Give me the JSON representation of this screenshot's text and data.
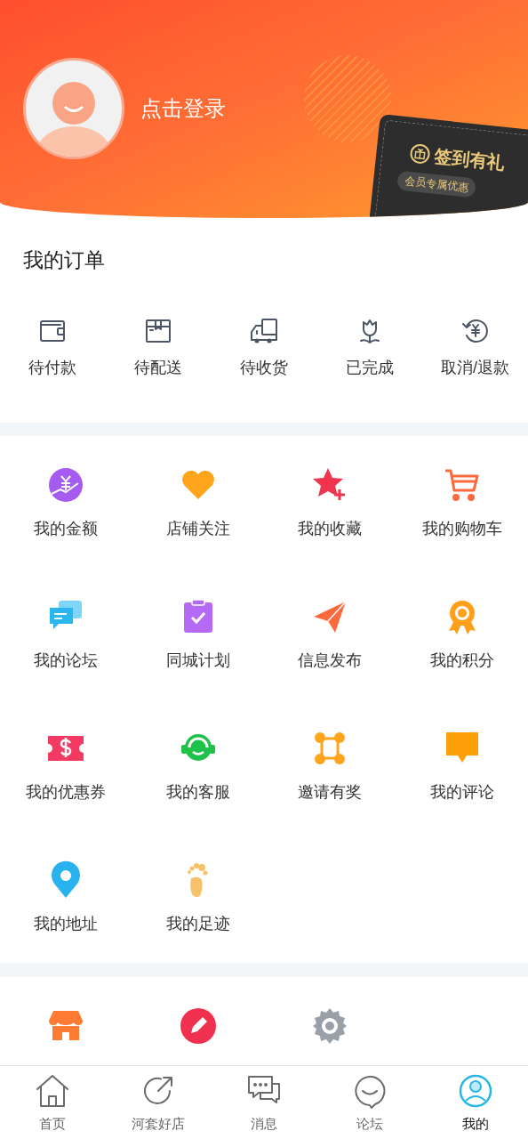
{
  "header": {
    "login_text": "点击登录",
    "sign_in": {
      "title": "签到有礼",
      "subtitle": "会员专属优惠"
    }
  },
  "orders": {
    "title": "我的订单",
    "items": [
      {
        "label": "待付款",
        "kind": "wallet"
      },
      {
        "label": "待配送",
        "kind": "box"
      },
      {
        "label": "待收货",
        "kind": "truck"
      },
      {
        "label": "已完成",
        "kind": "flower"
      },
      {
        "label": "取消/退款",
        "kind": "refund"
      }
    ]
  },
  "services": [
    {
      "label": "我的金额",
      "kind": "money"
    },
    {
      "label": "店铺关注",
      "kind": "heart"
    },
    {
      "label": "我的收藏",
      "kind": "star"
    },
    {
      "label": "我的购物车",
      "kind": "cart"
    },
    {
      "label": "我的论坛",
      "kind": "chat"
    },
    {
      "label": "同城计划",
      "kind": "clipboard"
    },
    {
      "label": "信息发布",
      "kind": "plane"
    },
    {
      "label": "我的积分",
      "kind": "medal"
    },
    {
      "label": "我的优惠券",
      "kind": "coupon"
    },
    {
      "label": "我的客服",
      "kind": "headset"
    },
    {
      "label": "邀请有奖",
      "kind": "nodes"
    },
    {
      "label": "我的评论",
      "kind": "comment"
    },
    {
      "label": "我的地址",
      "kind": "pin"
    },
    {
      "label": "我的足迹",
      "kind": "foot"
    }
  ],
  "more_services": [
    {
      "kind": "store"
    },
    {
      "kind": "pencil"
    },
    {
      "kind": "gear"
    }
  ],
  "tabs": [
    {
      "label": "首页",
      "kind": "home",
      "selected": false
    },
    {
      "label": "河套好店",
      "kind": "share",
      "selected": false
    },
    {
      "label": "消息",
      "kind": "messages",
      "selected": false
    },
    {
      "label": "论坛",
      "kind": "smile",
      "selected": false
    },
    {
      "label": "我的",
      "kind": "user",
      "selected": true
    }
  ]
}
